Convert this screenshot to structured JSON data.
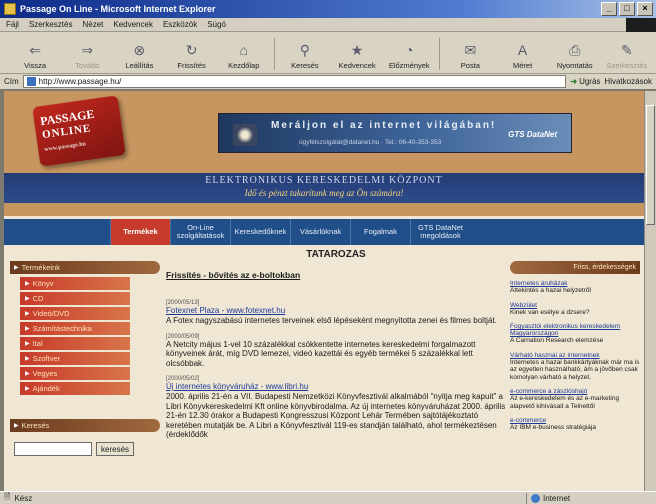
{
  "window": {
    "title": "Passage On Line - Microsoft Internet Explorer"
  },
  "menu": [
    "Fájl",
    "Szerkesztés",
    "Nézet",
    "Kedvencek",
    "Eszközök",
    "Súgó"
  ],
  "toolbar": {
    "back": "Vissza",
    "forward": "Tovább",
    "stop": "Leállítás",
    "refresh": "Frissítés",
    "home": "Kezdőlap",
    "search": "Keresés",
    "favorites": "Kedvencek",
    "history": "Előzmények",
    "mail": "Posta",
    "size": "Méret",
    "print": "Nyomtatás",
    "edit": "Szerkesztés"
  },
  "address": {
    "label": "Cím",
    "url": "http://www.passage.hu/",
    "go": "Ugrás",
    "links": "Hivatkozások"
  },
  "header": {
    "logo_line1": "PASSAGE",
    "logo_line2": "ONLINE",
    "logo_line3": "www.passage.hu",
    "ad_line1": "Meráljon el az internet világában!",
    "ad_line2": "ügyfélszolgálat@datanet.hu · Tel.: 06-40-353-353",
    "ad_brand": "GTS DataNet",
    "center_title": "ELEKTRONIKUS KERESKEDELMI KÖZPONT",
    "slogan": "Idő és pénzt takarítunk meg az Ön számára!"
  },
  "nav": [
    "Termékek",
    "On-Line szolgáltatások",
    "Kereskedőknek",
    "Vásárlóknak",
    "Fogalmak",
    "GTS DataNet megoldások"
  ],
  "left": {
    "section_title": "Termékeink",
    "items": [
      "Könyv",
      "CD",
      "Videó/DVD",
      "Számítástechnika",
      "Ital",
      "Szoftver",
      "Vegyes",
      "Ajándék"
    ],
    "search_title": "Keresés",
    "search_value": "",
    "search_button": "keresés"
  },
  "content": {
    "title": "TATAROZÁS",
    "subtitle": "Frissítés - bővítés az e-boltokban",
    "news": [
      {
        "date": "[2000/05/13]",
        "link": "Fotexnet Plaza - www.fotexnet.hu",
        "text": "A Fotex nagyszabású internetes terveinek első lépéseként megnyitotta zenei és filmes boltját."
      },
      {
        "date": "[2000/05/09]",
        "link": "",
        "text": "A Netcity május 1-vel 10 százalékkal csökkentette internetes kereskedelmi forgalmazott könyveinek árát, míg DVD lemezei, videó kazettái és egyéb termékei 5 százalékkal lett olcsóbbak."
      },
      {
        "date": "[2000/05/02]",
        "link": "Új internetes könyváruház - www.libri.hu",
        "text": "2000. április 21-én a VII. Budapesti Nemzetközi Könyvfesztivál alkalmából \"nyitja meg kapuit\" a Libri Könyvkereskedelmi Kft online könyvbirodalma. Az új internetes könyváruházat 2000. április 21-én 12.30 órakor a Budapesti Kongresszusi Központ Lehár Termében sajtótájékoztató keretében mutatják be. A Libri a Könyvfesztivál 119-es standján található, ahol termékeztésen (érdeklődők"
      }
    ]
  },
  "right": {
    "title": "Friss, érdekességek",
    "items": [
      {
        "link": "Internetes áruházak",
        "text": "Áttekintés a hazai helyzetről"
      },
      {
        "link": "Webzület",
        "text": "Kinek van esélye a dzsere?"
      },
      {
        "link": "Fogyasztói elektronikus kereskedelem Magyarországon",
        "text": "A Carnation Research elemzése"
      },
      {
        "link": "Várható hasznai az internetnek",
        "text": "Internetes a hazai bankkártyáknak már ma is az egyetlen használható, ám a jövőben csak komolyan várható a helyzet."
      },
      {
        "link": "e-commerce a zászlóshajó",
        "text": "Az e-kereskedelem és az e-marketing alapvető kihívásait a Telnettől"
      },
      {
        "link": "e-commerce",
        "text": "Az IBM e-business stratégiája"
      }
    ]
  },
  "status": {
    "text": "Kész",
    "zone": "Internet"
  }
}
